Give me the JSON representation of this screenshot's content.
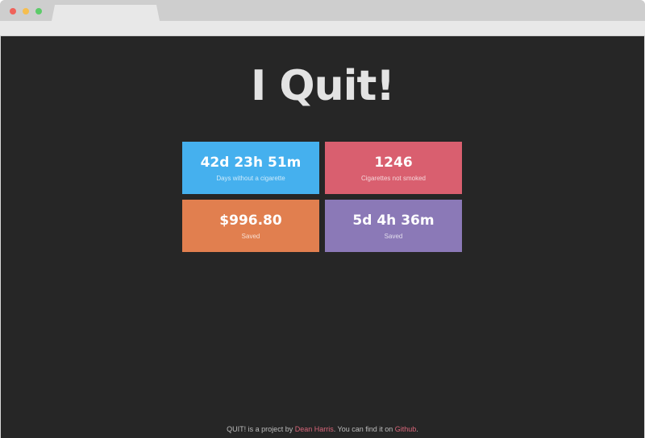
{
  "browser": {
    "window_controls": [
      "close",
      "minimize",
      "maximize"
    ]
  },
  "page": {
    "title": "I Quit!",
    "cards": [
      {
        "value": "42d 23h 51m",
        "label": "Days without a cigarette",
        "color": "#45b0ee"
      },
      {
        "value": "1246",
        "label": "Cigarettes not smoked",
        "color": "#d95f6f"
      },
      {
        "value": "$996.80",
        "label": "Saved",
        "color": "#e17f4f"
      },
      {
        "value": "5d 4h 36m",
        "label": "Saved",
        "color": "#8b79b7"
      }
    ],
    "footer": {
      "prefix": "QUIT! is a project by ",
      "author_link": "Dean Harris",
      "middle": ". You can find it on ",
      "repo_link": "Github",
      "suffix": "."
    }
  },
  "colors": {
    "background": "#262626",
    "title": "#e3e3e3",
    "link": "#d9667a"
  }
}
